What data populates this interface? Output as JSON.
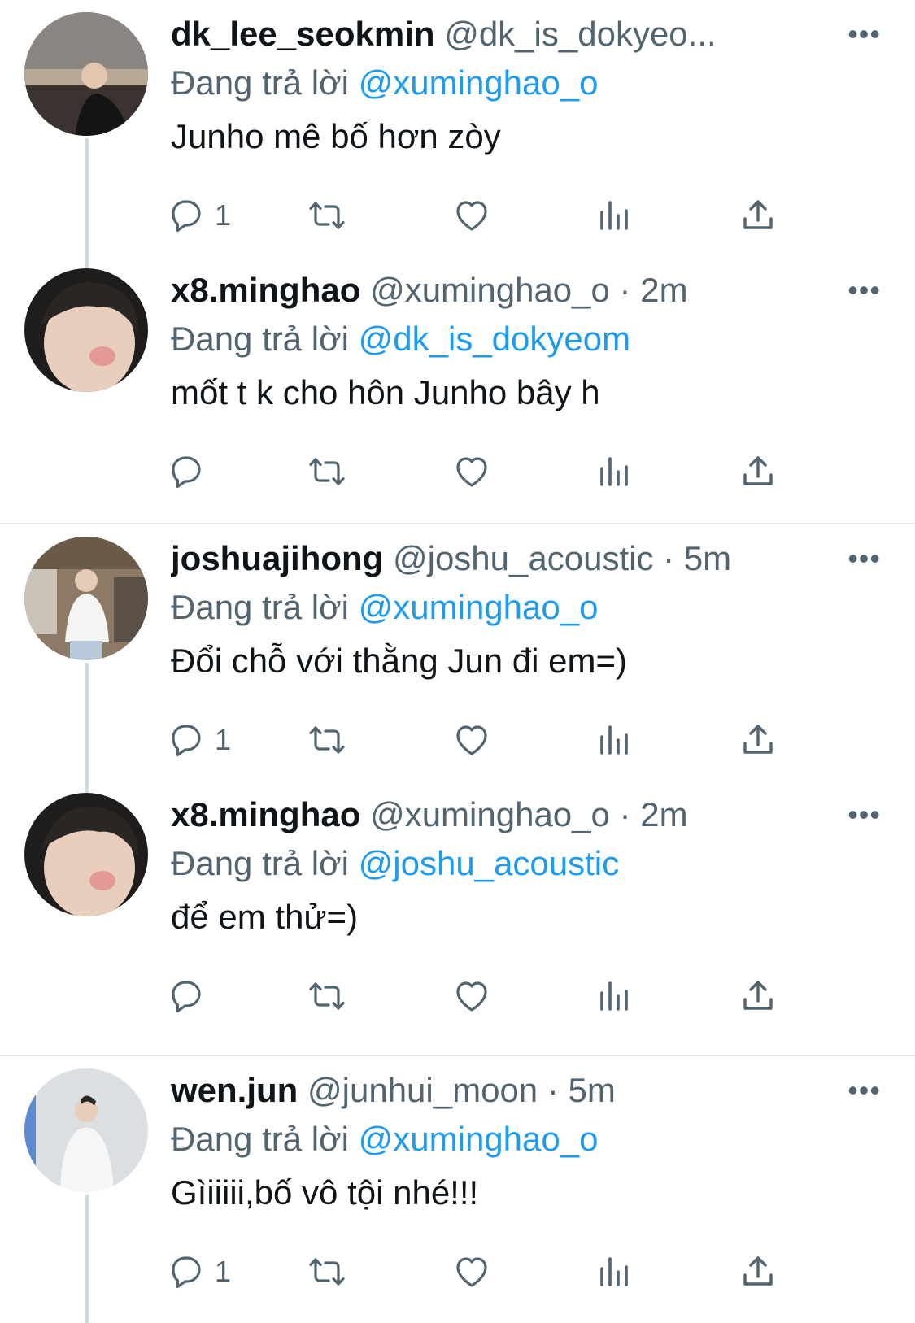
{
  "tweets": [
    {
      "name": "dk_lee_seokmin",
      "handle": "@dk_is_dokyeo...",
      "time": "",
      "reply_prefix": "Đang trả lời",
      "reply_to": "@xuminghao_o",
      "text": "Junho mê bố hơn zòy",
      "reply_count": "1",
      "avatar_color": "#3a3330"
    },
    {
      "name": "x8.minghao",
      "handle": "@xuminghao_o · 2m",
      "time": "",
      "reply_prefix": "Đang trả lời",
      "reply_to": "@dk_is_dokyeom",
      "text": "mốt t k cho hôn Junho bây h",
      "reply_count": "",
      "avatar_color": "#4b4641"
    },
    {
      "name": "joshuajihong",
      "handle": "@joshu_acoustic · 5m",
      "time": "",
      "reply_prefix": "Đang trả lời",
      "reply_to": "@xuminghao_o",
      "text": "Đổi chỗ với thằng Jun đi em=)",
      "reply_count": "1",
      "avatar_color": "#8c7a66"
    },
    {
      "name": "x8.minghao",
      "handle": "@xuminghao_o · 2m",
      "time": "",
      "reply_prefix": "Đang trả lời",
      "reply_to": "@joshu_acoustic",
      "text": "để em thử=)",
      "reply_count": "",
      "avatar_color": "#4b4641"
    },
    {
      "name": "wen.jun",
      "handle": "@junhui_moon · 5m",
      "time": "",
      "reply_prefix": "Đang trả lời",
      "reply_to": "@xuminghao_o",
      "text": "Gìiiiii,bố vô tội nhé!!!",
      "reply_count": "1",
      "avatar_color": "#d9dcdf"
    }
  ],
  "more_label": "•••",
  "colors": {
    "accent": "#1d9bf0",
    "secondary": "#536471",
    "text": "#0f1419"
  },
  "icons": [
    "reply-icon",
    "retweet-icon",
    "like-icon",
    "views-icon",
    "share-icon",
    "more-icon"
  ]
}
